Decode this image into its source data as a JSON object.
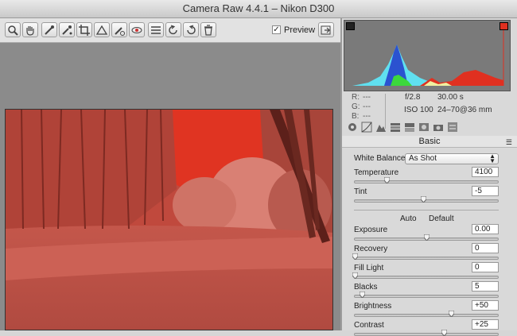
{
  "window": {
    "title": "Camera Raw 4.4.1  –  Nikon D300"
  },
  "toolbar": {
    "tools": [
      {
        "name": "zoom-tool-icon"
      },
      {
        "name": "hand-tool-icon"
      },
      {
        "name": "white-balance-tool-icon"
      },
      {
        "name": "color-sampler-tool-icon"
      },
      {
        "name": "crop-tool-icon"
      },
      {
        "name": "straighten-tool-icon"
      },
      {
        "name": "retouch-tool-icon"
      },
      {
        "name": "red-eye-tool-icon"
      },
      {
        "name": "preferences-icon"
      },
      {
        "name": "rotate-left-icon"
      },
      {
        "name": "rotate-right-icon"
      },
      {
        "name": "delete-icon"
      }
    ],
    "preview_label": "Preview",
    "preview_checked": true
  },
  "histogram": {
    "shadow_clip_color": "#222222",
    "highlight_clip_color": "#e03020"
  },
  "readout": {
    "r_label": "R:",
    "g_label": "G:",
    "b_label": "B:",
    "r_value": "---",
    "g_value": "---",
    "b_value": "---",
    "aperture": "f/2.8",
    "shutter": "30.00 s",
    "iso": "ISO 100",
    "lens": "24–70@36 mm"
  },
  "panel": {
    "section_title": "Basic",
    "white_balance_label": "White Balance:",
    "white_balance_value": "As Shot",
    "auto_label": "Auto",
    "default_label": "Default",
    "sliders": [
      {
        "label": "Temperature",
        "value": "4100",
        "level": 0.22
      },
      {
        "label": "Tint",
        "value": "-5",
        "level": 0.48
      },
      {
        "label": "Exposure",
        "value": "0.00",
        "level": 0.5
      },
      {
        "label": "Recovery",
        "value": "0",
        "level": 0.0
      },
      {
        "label": "Fill Light",
        "value": "0",
        "level": 0.0
      },
      {
        "label": "Blacks",
        "value": "5",
        "level": 0.05
      },
      {
        "label": "Brightness",
        "value": "+50",
        "level": 0.67
      },
      {
        "label": "Contrast",
        "value": "+25",
        "level": 0.62
      }
    ]
  }
}
